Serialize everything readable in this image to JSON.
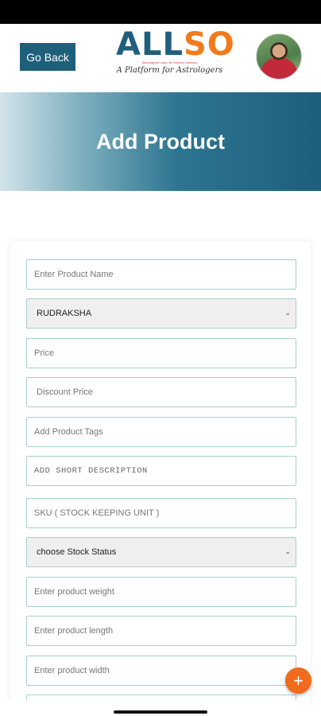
{
  "header": {
    "go_back_label": "Go Back",
    "logo_text_a": "ALL",
    "logo_text_b": "SO",
    "logo_small": "Astrological Long Life Service Operator",
    "logo_tagline": "A Platform for Astrologers"
  },
  "banner": {
    "title": "Add Product"
  },
  "form": {
    "product_name_placeholder": "Enter Product Name",
    "category_selected": "RUDRAKSHA",
    "price_placeholder": "Price",
    "discount_placeholder": "Discount Price",
    "tags_placeholder": "Add Product Tags",
    "short_desc_placeholder": "ADD SHORT DESCRIPTION",
    "sku_placeholder": "SKU ( STOCK KEEPING UNIT )",
    "stock_status_selected": "choose Stock Status",
    "weight_placeholder": "Enter product  weight",
    "length_placeholder": "Enter product length",
    "width_placeholder": "Enter product width"
  },
  "fab_label": "+",
  "colors": {
    "primary": "#1e5f7a",
    "accent": "#f26a1b"
  }
}
